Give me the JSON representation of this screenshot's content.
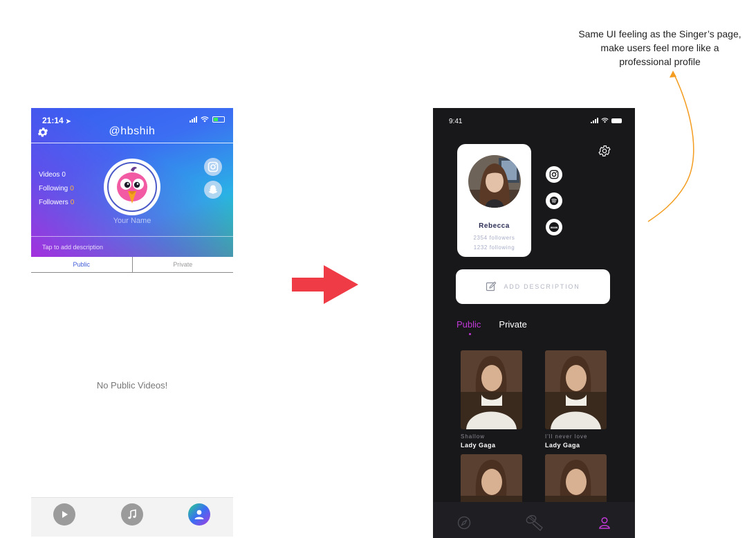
{
  "old_screen": {
    "status_time": "21:14",
    "handle": "@hbshih",
    "stats": [
      {
        "label": "Videos",
        "value": "0"
      },
      {
        "label": "Following",
        "value": "0"
      },
      {
        "label": "Followers",
        "value": "0"
      }
    ],
    "name_placeholder": "Your Name",
    "description_placeholder": "Tap to add description",
    "tabs": [
      {
        "label": "Public",
        "active": true
      },
      {
        "label": "Private",
        "active": false
      }
    ],
    "empty_message": "No Public Videos!",
    "tabbar_icons": [
      "play-icon",
      "music-icon",
      "profile-icon"
    ],
    "colors": {
      "accent": "#3f5bd8",
      "stat_value": "#ffb43a"
    }
  },
  "note": {
    "text_line1": "Same UI feeling as the Singer’s page,",
    "text_line2": "make users feel more like a",
    "text_line3": "professional profile",
    "color": "#f39c1f"
  },
  "arrow_color": "#ee3b46",
  "new_screen": {
    "status_time": "9:41",
    "profile": {
      "name": "Rebecca",
      "followers": "2354 followers",
      "following": "1232 following"
    },
    "social_icons": [
      "instagram-icon",
      "spotify-icon",
      "www-icon"
    ],
    "description_button": "ADD DESCRIPTION",
    "tabs": [
      {
        "label": "Public",
        "active": true
      },
      {
        "label": "Private",
        "active": false
      }
    ],
    "videos": [
      {
        "title": "Shallow",
        "artist": "Lady Gaga"
      },
      {
        "title": "I'll never love",
        "artist": "Lady Gaga"
      },
      {
        "title": "",
        "artist": ""
      },
      {
        "title": "",
        "artist": ""
      }
    ],
    "tabbar_icons": [
      "compass-icon",
      "microphone-icon",
      "profile-icon"
    ],
    "colors": {
      "background": "#18181b",
      "accent": "#c238d8"
    }
  }
}
